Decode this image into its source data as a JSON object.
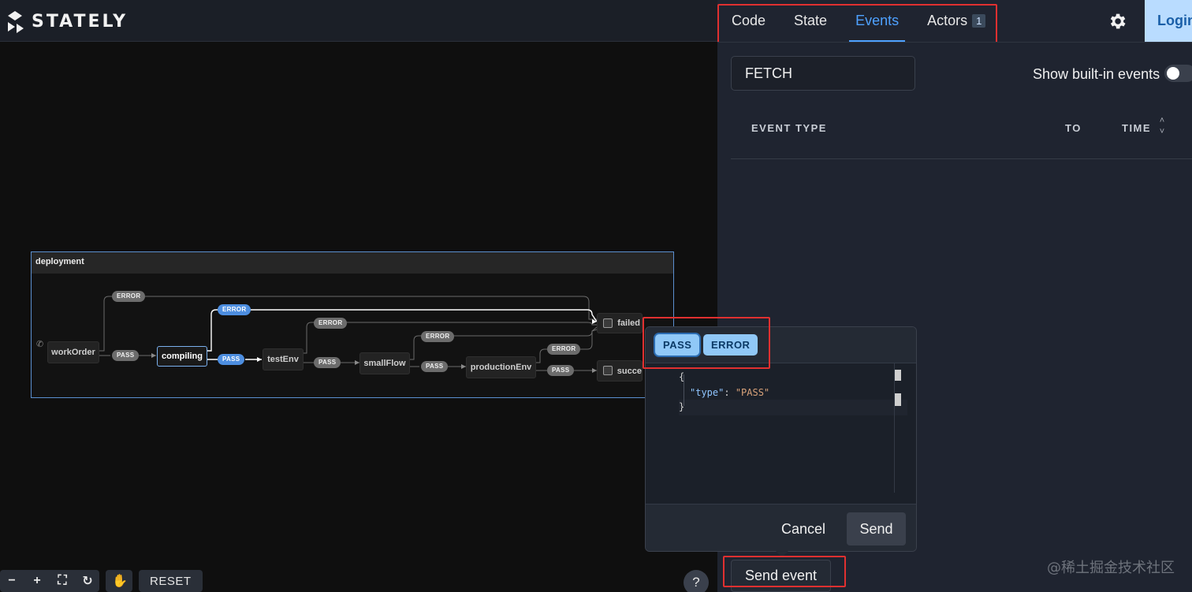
{
  "app": {
    "logo_text": "STATELY"
  },
  "tabs": [
    {
      "label": "Code"
    },
    {
      "label": "State"
    },
    {
      "label": "Events"
    },
    {
      "label": "Actors",
      "badge": "1"
    }
  ],
  "header": {
    "login_label": "Login"
  },
  "events_panel": {
    "filter_value": "FETCH",
    "show_builtin_label": "Show built-in events",
    "columns": {
      "event_type": "EVENT TYPE",
      "to": "TO",
      "time": "TIME"
    }
  },
  "machine": {
    "title": "deployment",
    "states": {
      "workOrder": "workOrder",
      "compiling": "compiling",
      "testEnv": "testEnv",
      "smallFlow": "smallFlow",
      "productionEnv": "productionEnv",
      "failed": "failed",
      "success": "succe"
    },
    "events": {
      "error": "ERROR",
      "pass": "PASS"
    }
  },
  "toolbar": {
    "zoom_out": "−",
    "zoom_in": "+",
    "fit": "⛶",
    "rotate": "↻",
    "pan": "✋",
    "reset_label": "RESET",
    "help": "?"
  },
  "popover": {
    "chip_pass": "PASS",
    "chip_error": "ERROR",
    "code_open": "{",
    "code_key": "\"type\"",
    "code_sep": ": ",
    "code_value": "\"PASS\"",
    "code_close": "}",
    "cancel_label": "Cancel",
    "send_label": "Send"
  },
  "send_event_label": "Send event",
  "watermark": "@稀土掘金技术社区",
  "colors": {
    "accent": "#4ea1ff",
    "highlight": "#e03030",
    "chip": "#90c8f7",
    "panel": "#1f2430"
  }
}
